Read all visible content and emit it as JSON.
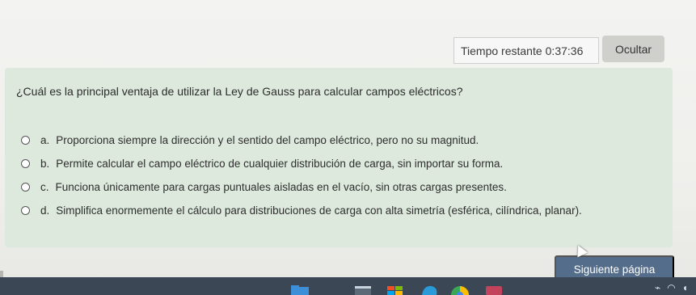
{
  "timer": {
    "label": "Tiempo restante",
    "value": "0:37:36"
  },
  "hide_button": "Ocultar",
  "question": {
    "text": "¿Cuál es la principal ventaja de utilizar la Ley de Gauss para calcular campos eléctricos?",
    "options": [
      {
        "letter": "a.",
        "text": "Proporciona siempre la dirección y el sentido del campo eléctrico, pero no su magnitud."
      },
      {
        "letter": "b.",
        "text": "Permite calcular el campo eléctrico de cualquier distribución de carga, sin importar su forma."
      },
      {
        "letter": "c.",
        "text": "Funciona únicamente para cargas puntuales aisladas en el vacío, sin otras cargas presentes."
      },
      {
        "letter": "d.",
        "text": "Simplifica enormemente el cálculo para distribuciones de carga con alta simetría (esférica, cilíndrica, planar)."
      }
    ]
  },
  "next_button": "Siguiente página",
  "colors": {
    "panel": "#dde9dd",
    "next_button": "#546d8a",
    "taskbar": "#3b4755"
  },
  "taskbar_icons": [
    "file-explorer-icon",
    "terminal-icon",
    "store-icon",
    "edge-browser-icon",
    "chrome-browser-icon",
    "app-icon",
    "tray-icon",
    "wifi-icon",
    "volume-icon"
  ]
}
